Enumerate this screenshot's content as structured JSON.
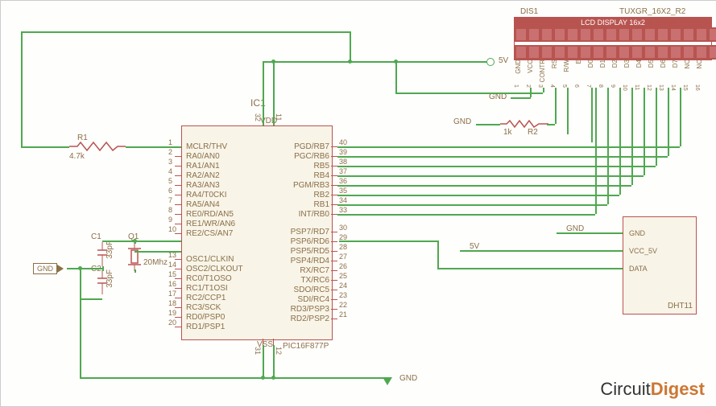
{
  "logo_left": "Circuit",
  "logo_right": "Digest",
  "lcd": {
    "ref": "DIS1",
    "part": "TUXGR_16X2_R2",
    "title": "LCD DISPLAY 16x2",
    "pins": [
      "GND",
      "VCC",
      "CONTR",
      "RS",
      "R/W",
      "E",
      "D0",
      "D1",
      "D2",
      "D3",
      "D4",
      "D5",
      "D6",
      "D7",
      "NC",
      "NC"
    ],
    "pin_nums": [
      "1",
      "2",
      "3",
      "4",
      "5",
      "6",
      "7",
      "8",
      "9",
      "10",
      "11",
      "12",
      "13",
      "14",
      "15",
      "16"
    ]
  },
  "ic1": {
    "ref": "IC1",
    "part": "PIC16F877P",
    "left_pins": [
      {
        "n": "1",
        "name": "MCLR/THV"
      },
      {
        "n": "2",
        "name": "RA0/AN0"
      },
      {
        "n": "3",
        "name": "RA1/AN1"
      },
      {
        "n": "4",
        "name": "RA2/AN2"
      },
      {
        "n": "5",
        "name": "RA3/AN3"
      },
      {
        "n": "6",
        "name": "RA4/T0CKI"
      },
      {
        "n": "7",
        "name": "RA5/AN4"
      },
      {
        "n": "8",
        "name": "RE0/RD/AN5"
      },
      {
        "n": "9",
        "name": "RE1/WR/AN6"
      },
      {
        "n": "10",
        "name": "RE2/CS/AN7"
      },
      {
        "n": "13",
        "name": "OSC1/CLKIN"
      },
      {
        "n": "14",
        "name": "OSC2/CLKOUT"
      },
      {
        "n": "15",
        "name": "RC0/T1OSO"
      },
      {
        "n": "16",
        "name": "RC1/T1OSI"
      },
      {
        "n": "17",
        "name": "RC2/CCP1"
      },
      {
        "n": "18",
        "name": "RC3/SCK"
      },
      {
        "n": "19",
        "name": "RD0/PSP0"
      },
      {
        "n": "20",
        "name": "RD1/PSP1"
      }
    ],
    "right_pins": [
      {
        "n": "40",
        "name": "PGD/RB7"
      },
      {
        "n": "39",
        "name": "PGC/RB6"
      },
      {
        "n": "38",
        "name": "RB5"
      },
      {
        "n": "37",
        "name": "RB4"
      },
      {
        "n": "36",
        "name": "PGM/RB3"
      },
      {
        "n": "35",
        "name": "RB2"
      },
      {
        "n": "34",
        "name": "RB1"
      },
      {
        "n": "33",
        "name": "INT/RB0"
      },
      {
        "n": "30",
        "name": "PSP7/RD7"
      },
      {
        "n": "29",
        "name": "PSP6/RD6"
      },
      {
        "n": "28",
        "name": "PSP5/RD5"
      },
      {
        "n": "27",
        "name": "PSP4/RD4"
      },
      {
        "n": "26",
        "name": "RX/RC7"
      },
      {
        "n": "25",
        "name": "TX/RC6"
      },
      {
        "n": "24",
        "name": "SDO/RC5"
      },
      {
        "n": "23",
        "name": "SDI/RC4"
      },
      {
        "n": "22",
        "name": "RD3/PSP3"
      },
      {
        "n": "21",
        "name": "RD2/PSP2"
      }
    ],
    "vdd": "VDD",
    "vss": "VSS",
    "vdd_pins": [
      "11",
      "32"
    ],
    "vss_pins": [
      "12",
      "31"
    ]
  },
  "dht": {
    "part": "DHT11",
    "pins": [
      "GND",
      "VCC_5V",
      "DATA"
    ]
  },
  "labels": {
    "r1": "R1",
    "r1_val": "4.7k",
    "r2": "R2",
    "r2_val": "1k",
    "c1": "C1",
    "c1_val": "33pF",
    "c2": "C2",
    "c2_val": "33pF",
    "q1": "Q1",
    "q1_val": "20Mhz",
    "gnd": "GND",
    "v5": "5V"
  }
}
